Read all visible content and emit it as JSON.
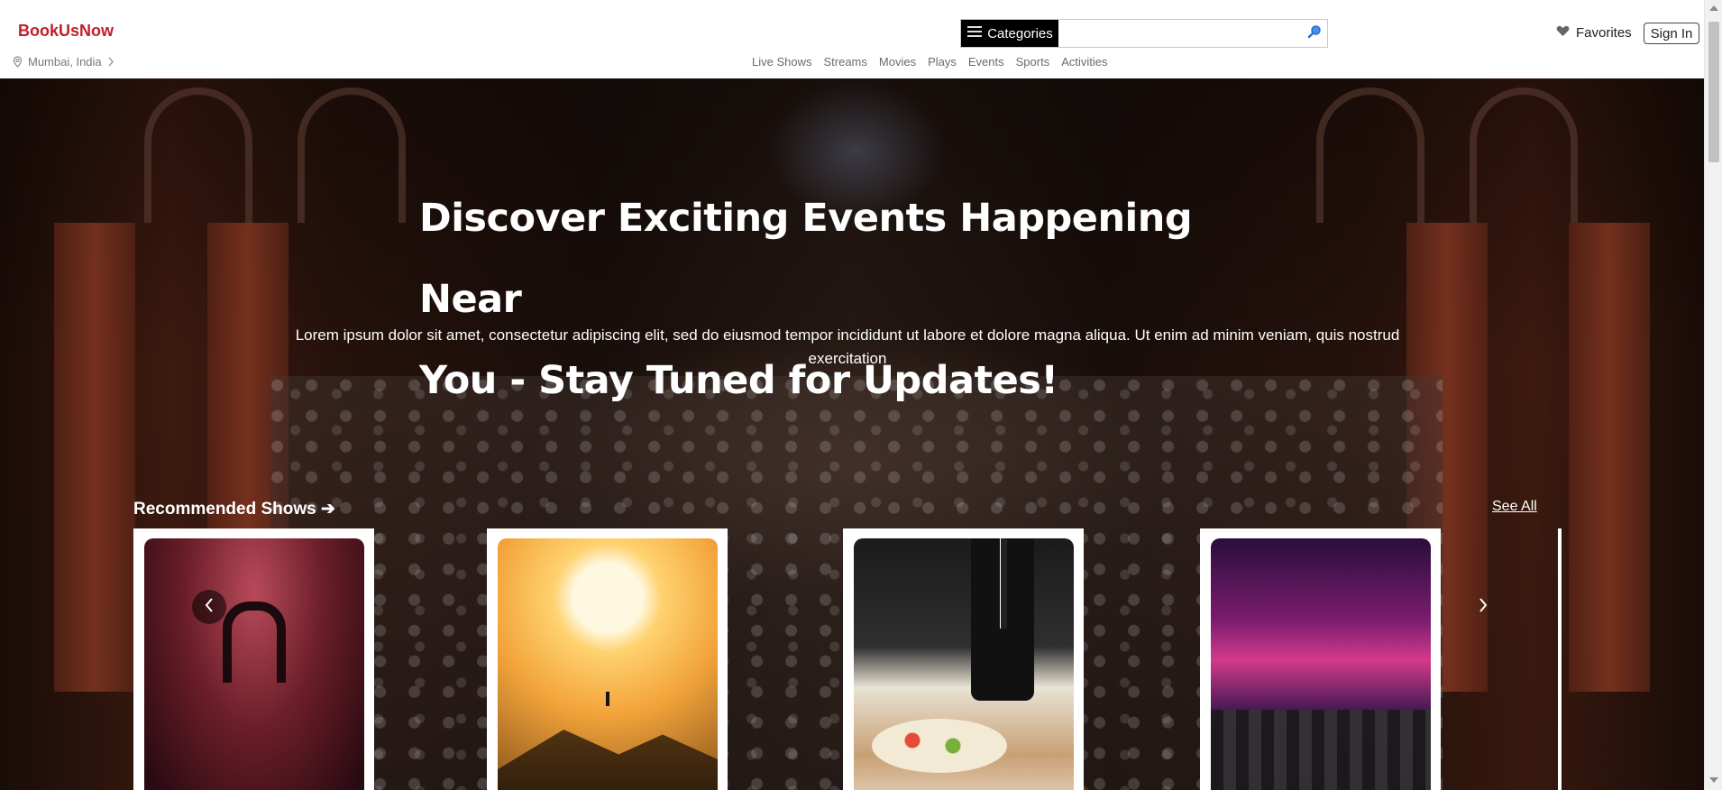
{
  "header": {
    "brand": "BookUsNow",
    "location": "Mumbai, India",
    "categories_label": "Categories",
    "search_placeholder": "",
    "nav": [
      "Live Shows",
      "Streams",
      "Movies",
      "Plays",
      "Events",
      "Sports",
      "Activities"
    ],
    "favorites_label": "Favorites",
    "signin_label": "Sign In"
  },
  "hero": {
    "title_line1": "Discover Exciting Events Happening Near",
    "title_line2": "You - Stay Tuned for Updates!",
    "description": "Lorem ipsum dolor sit amet, consectetur adipiscing elit, sed do eiusmod tempor incididunt ut labore et dolore magna aliqua. Ut enim ad minim veniam, quis nostrud exercitation"
  },
  "recommended": {
    "title": "Recommended Shows ➔",
    "see_all": "See All",
    "cards": [
      {
        "image": "concert-performer"
      },
      {
        "image": "sunset-mountain"
      },
      {
        "image": "catering-waiter"
      },
      {
        "image": "audio-mixer"
      }
    ]
  },
  "colors": {
    "brand": "#c21d2b",
    "categories_bg": "#000000",
    "search_icon": "#1f6fd1"
  },
  "icons": {
    "location": "map-pin-icon",
    "chevron": "chevron-right-icon",
    "menu": "hamburger-icon",
    "search": "search-icon",
    "favorites": "heart-icon",
    "prev": "chevron-left-icon",
    "next": "chevron-right-icon"
  }
}
